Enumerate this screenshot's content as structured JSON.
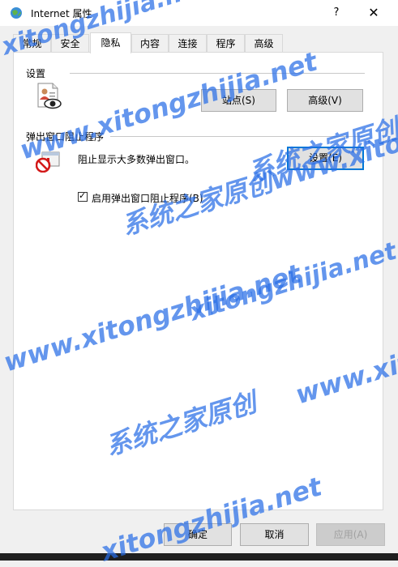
{
  "window": {
    "title": "Internet 属性",
    "help_glyph": "?",
    "close_glyph": "✕"
  },
  "tabs": [
    {
      "label": "常规"
    },
    {
      "label": "安全"
    },
    {
      "label": "隐私",
      "active": true
    },
    {
      "label": "内容"
    },
    {
      "label": "连接"
    },
    {
      "label": "程序"
    },
    {
      "label": "高级"
    }
  ],
  "settings": {
    "heading": "设置",
    "sites_button": "站点(S)",
    "advanced_button": "高级(V)"
  },
  "popup_blocker": {
    "heading": "弹出窗口阻止程序",
    "description": "阻止显示大多数弹出窗口。",
    "settings_button": "设置(E)",
    "enable_checkbox_label": "启用弹出窗口阻止程序(B)",
    "enable_checked": true,
    "check_glyph": "✓"
  },
  "footer": {
    "ok_button": "确定",
    "cancel_button": "取消",
    "apply_button": "应用(A)"
  },
  "watermarks": [
    "xitongzhijia.net",
    "www.xitongzhijia.net",
    "系统之家原创www.xitongzhijia.net",
    "www.xitongzhijia.net",
    "系统之家原创",
    "xitongzhijia.net",
    "www.xito",
    "系统之家原创www.xitongzhijia.net",
    "xitongzhijia.net"
  ],
  "colors": {
    "focus_border": "#0078d7",
    "watermark": "#2f6fe0",
    "window_bg": "#f0f0f0",
    "panel_bg": "#ffffff"
  },
  "icons": {
    "app": "internet-options-globe-icon",
    "privacy": "privacy-person-eye-icon",
    "popup": "popup-blocked-icon"
  }
}
